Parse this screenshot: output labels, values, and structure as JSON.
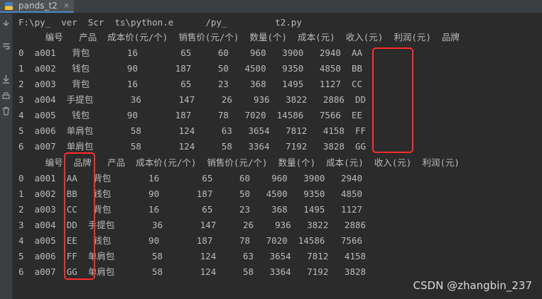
{
  "tab": {
    "label": "pands_t2"
  },
  "console": {
    "path_line": "F:\\py_  ver  Scr  ts\\python.e      /py_         t2.py",
    "table1": {
      "header": "     编号   产品  成本价(元/个)  销售价(元/个)  数量(个)  成本(元)  收入(元)  利润(元)  品牌",
      "rows": [
        "0  a001   背包       16        65     60    960   3900   2940  AA",
        "1  a002   钱包       90       187     50   4500   9350   4850  BB",
        "2  a003   背包       16        65     23    368   1495   1127  CC",
        "3  a004  手提包       36       147     26    936   3822   2886  DD",
        "4  a005   钱包       90       187     78   7020  14586   7566  EE",
        "5  a006  单肩包       58       124     63   3654   7812   4158  FF",
        "6  a007  单肩包       58       124     58   3364   7192   3828  GG"
      ]
    },
    "table2": {
      "header": "     编号  品牌   产品  成本价(元/个)  销售价(元/个)  数量(个)  成本(元)  收入(元)  利润(元)",
      "rows": [
        "0  a001  AA   背包       16        65     60    960   3900   2940",
        "1  a002  BB   钱包       90       187     50   4500   9350   4850",
        "2  a003  CC   背包       16        65     23    368   1495   1127",
        "3  a004  DD  手提包       36       147     26    936   3822   2886",
        "4  a005  EE   钱包       90       187     78   7020  14586   7566",
        "5  a006  FF  单肩包       58       124     63   3654   7812   4158",
        "6  a007  GG  单肩包       58       124     58   3364   7192   3828"
      ]
    }
  },
  "watermark": "CSDN @zhangbin_237",
  "colors": {
    "highlight": "#ff2d2d",
    "background": "#2b2b2b",
    "text": "#bbbbbb"
  },
  "icons": [
    "python-file-icon",
    "close-icon",
    "rerun-icon",
    "scroll-down-icon",
    "soft-wrap-icon",
    "print-icon",
    "trash-icon"
  ]
}
